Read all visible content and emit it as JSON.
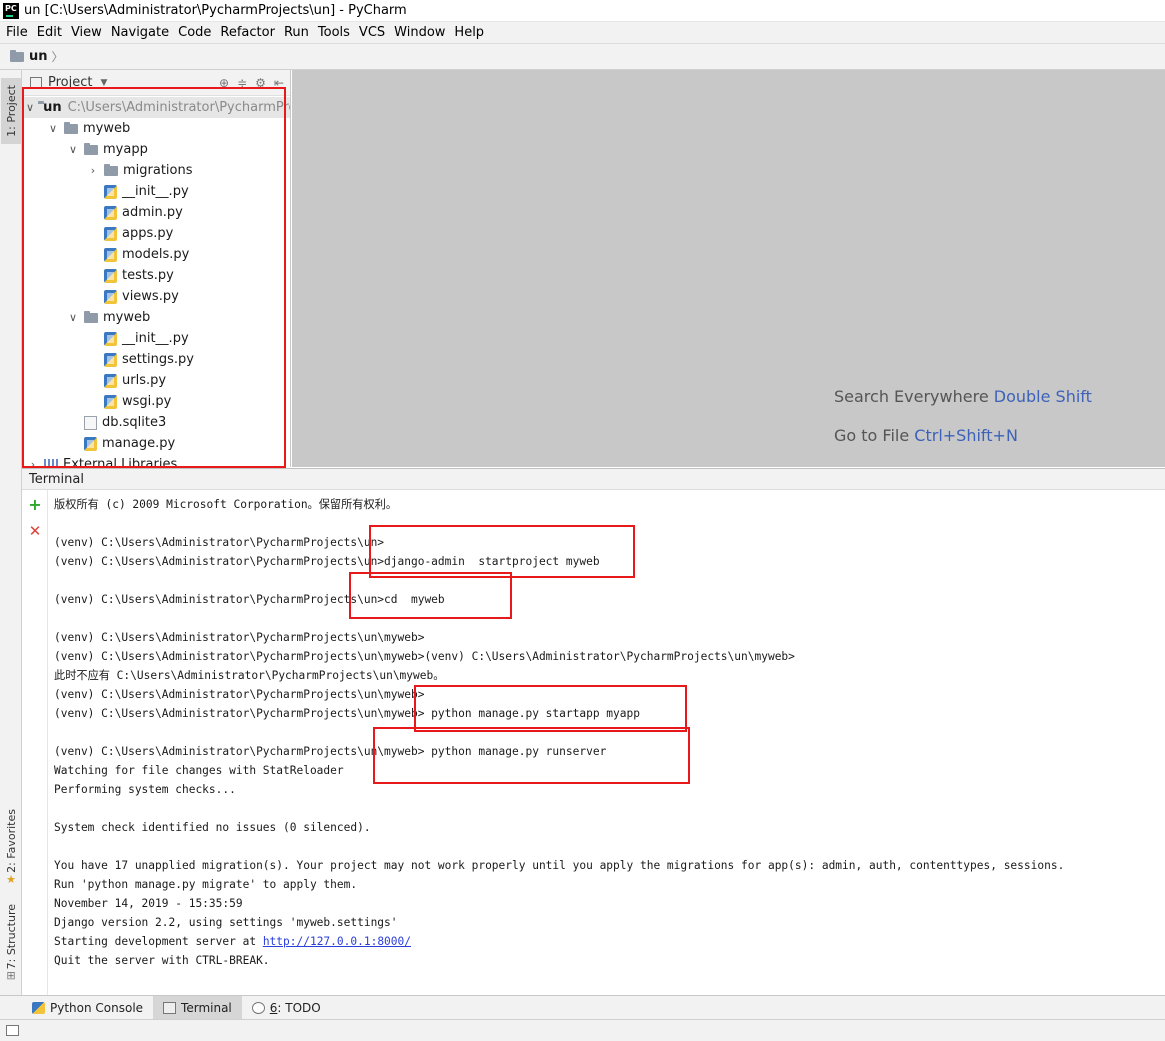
{
  "window": {
    "title": "un [C:\\Users\\Administrator\\PycharmProjects\\un] - PyCharm",
    "logo_text": "PC"
  },
  "menu": [
    "File",
    "Edit",
    "View",
    "Navigate",
    "Code",
    "Refactor",
    "Run",
    "Tools",
    "VCS",
    "Window",
    "Help"
  ],
  "navbar": {
    "project": "un"
  },
  "left_strip": {
    "project_tab": "1: Project",
    "favorites_tab": "2: Favorites",
    "structure_tab": "7: Structure"
  },
  "project_panel": {
    "header": "Project",
    "tree": [
      {
        "name": "un",
        "path": "C:\\Users\\Administrator\\PycharmProj",
        "type": "folder",
        "level": 0,
        "expanded": true,
        "bold": true,
        "selected": true
      },
      {
        "name": "myweb",
        "type": "folder",
        "level": 1,
        "expanded": true
      },
      {
        "name": "myapp",
        "type": "folder",
        "level": 2,
        "expanded": true
      },
      {
        "name": "migrations",
        "type": "folder",
        "level": 3,
        "expanded": false
      },
      {
        "name": "__init__.py",
        "type": "py",
        "level": 3
      },
      {
        "name": "admin.py",
        "type": "py",
        "level": 3
      },
      {
        "name": "apps.py",
        "type": "py",
        "level": 3
      },
      {
        "name": "models.py",
        "type": "py",
        "level": 3
      },
      {
        "name": "tests.py",
        "type": "py",
        "level": 3
      },
      {
        "name": "views.py",
        "type": "py",
        "level": 3
      },
      {
        "name": "myweb",
        "type": "folder",
        "level": 2,
        "expanded": true
      },
      {
        "name": "__init__.py",
        "type": "py",
        "level": 3
      },
      {
        "name": "settings.py",
        "type": "py",
        "level": 3
      },
      {
        "name": "urls.py",
        "type": "py",
        "level": 3
      },
      {
        "name": "wsgi.py",
        "type": "py",
        "level": 3
      },
      {
        "name": "db.sqlite3",
        "type": "db",
        "level": 2
      },
      {
        "name": "manage.py",
        "type": "py",
        "level": 2
      },
      {
        "name": "External Libraries",
        "type": "lib",
        "level": 0,
        "expanded": false
      }
    ]
  },
  "editor": {
    "hints": [
      {
        "text": "Search Everywhere",
        "shortcut": "Double Shift"
      },
      {
        "text": "Go to File",
        "shortcut": "Ctrl+Shift+N"
      }
    ]
  },
  "terminal": {
    "title": "Terminal",
    "lines": [
      "版权所有 (c) 2009 Microsoft Corporation。保留所有权利。",
      "",
      "(venv) C:\\Users\\Administrator\\PycharmProjects\\un>",
      "(venv) C:\\Users\\Administrator\\PycharmProjects\\un>django-admin  startproject myweb",
      "",
      "(venv) C:\\Users\\Administrator\\PycharmProjects\\un>cd  myweb",
      "",
      "(venv) C:\\Users\\Administrator\\PycharmProjects\\un\\myweb>",
      "(venv) C:\\Users\\Administrator\\PycharmProjects\\un\\myweb>(venv) C:\\Users\\Administrator\\PycharmProjects\\un\\myweb>",
      "此时不应有 C:\\Users\\Administrator\\PycharmProjects\\un\\myweb。",
      "(venv) C:\\Users\\Administrator\\PycharmProjects\\un\\myweb>",
      "(venv) C:\\Users\\Administrator\\PycharmProjects\\un\\myweb> python manage.py startapp myapp",
      "",
      "(venv) C:\\Users\\Administrator\\PycharmProjects\\un\\myweb> python manage.py runserver",
      "Watching for file changes with StatReloader",
      "Performing system checks...",
      "",
      "System check identified no issues (0 silenced).",
      "",
      "You have 17 unapplied migration(s). Your project may not work properly until you apply the migrations for app(s): admin, auth, contenttypes, sessions.",
      "Run 'python manage.py migrate' to apply them.",
      "November 14, 2019 - 15:35:59",
      "Django version 2.2, using settings 'myweb.settings'",
      "Starting development server at ",
      "Quit the server with CTRL-BREAK."
    ],
    "server_url": "http://127.0.0.1:8000/"
  },
  "bottom_tabs": [
    {
      "label": "Python Console",
      "active": false
    },
    {
      "label": "Terminal",
      "active": true
    },
    {
      "prefix": "6",
      "label": ": TODO",
      "active": false
    }
  ],
  "colors": {
    "highlight_box": "#e8191a",
    "shortcut_text": "#3d62b8",
    "link": "#2b3fd9"
  }
}
